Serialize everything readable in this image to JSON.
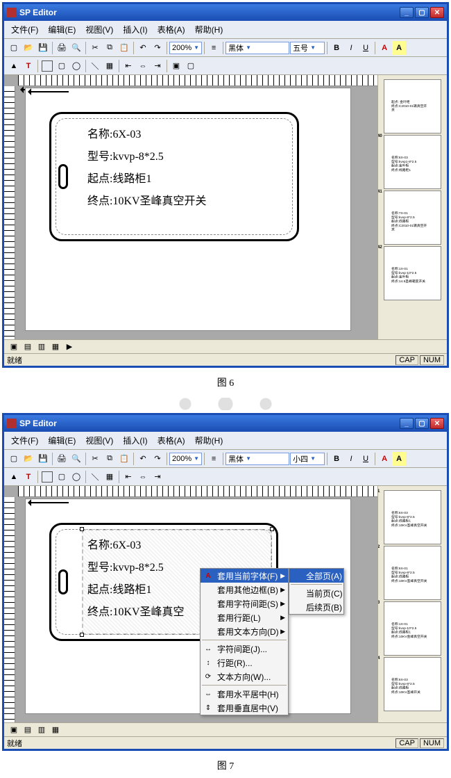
{
  "app_title": "SP Editor",
  "menus": [
    "文件(F)",
    "编辑(E)",
    "视图(V)",
    "插入(I)",
    "表格(A)",
    "帮助(H)"
  ],
  "zoom": "200%",
  "font": "黑体",
  "fontsize1": "五号",
  "fontsize2": "小四",
  "btn_b": "B",
  "btn_i": "I",
  "btn_u": "U",
  "btn_a1": "A",
  "btn_a2": "A",
  "fig1_caption": "图 6",
  "fig2_caption": "图 7",
  "label": {
    "l1": "名称:6X-03",
    "l2": "型号:kvvp-8*2.5",
    "l3": "起点:线路柜1",
    "l4": "终点:10KV圣峰真空开关",
    "l4b": "终点:10KV圣峰真空"
  },
  "thumbs1": [
    {
      "num": "",
      "lines": [
        "起点: 金叶柜",
        "终点:C2010-01辆真空开关"
      ]
    },
    {
      "num": "40",
      "lines": [
        "名称:6X-03",
        "型号:kvvp1-8*2.5",
        "起点:金叶柜",
        "终点:线路柜1"
      ]
    },
    {
      "num": "41",
      "lines": [
        "名称:7X-01",
        "型号:kvvp-8*2.5",
        "起点:线路柜",
        "终点:C2010-01辆真空开关"
      ]
    },
    {
      "num": "42",
      "lines": [
        "名称:1X-01",
        "型号:kvvp-10*2.5",
        "起点:金叶柜",
        "终点:14.5圣峰箱变开关"
      ]
    }
  ],
  "thumbs2": [
    {
      "num": "1",
      "lines": [
        "名称:6X-03",
        "型号:kvvp-8*2.5",
        "起点:线路柜1",
        "终点:10KV圣峰真空开关"
      ]
    },
    {
      "num": "2",
      "lines": [
        "名称:6X-01",
        "型号:kvvp-8*2.5",
        "起点:线路柜",
        "终点:10KV圣峰真空开关"
      ]
    },
    {
      "num": "3",
      "lines": [
        "名称:1X-01",
        "型号:kvvp-10*2.5",
        "起点:线路柜1",
        "终点:10KV金峰真空开关"
      ]
    },
    {
      "num": "4",
      "lines": [
        "名称:6X-03",
        "型号:kvvp-8*2.5",
        "起点:线路柜",
        "终点:10KV圣峰开关"
      ]
    }
  ],
  "ctx": {
    "c1": "套用当前字体(F)",
    "c2": "套用其他边框(B)",
    "c3": "套用字符间距(S)",
    "c4": "套用行距(L)",
    "c5": "套用文本方向(D)",
    "c6": "字符间距(J)...",
    "c7": "行距(R)...",
    "c8": "文本方向(W)...",
    "c9": "套用水平居中(H)",
    "c10": "套用垂直居中(V)"
  },
  "sub": {
    "s1": "全部页(A)",
    "s2": "当前页(C)",
    "s3": "后续页(B)"
  },
  "status": "就绪",
  "cap": "CAP",
  "num": "NUM"
}
